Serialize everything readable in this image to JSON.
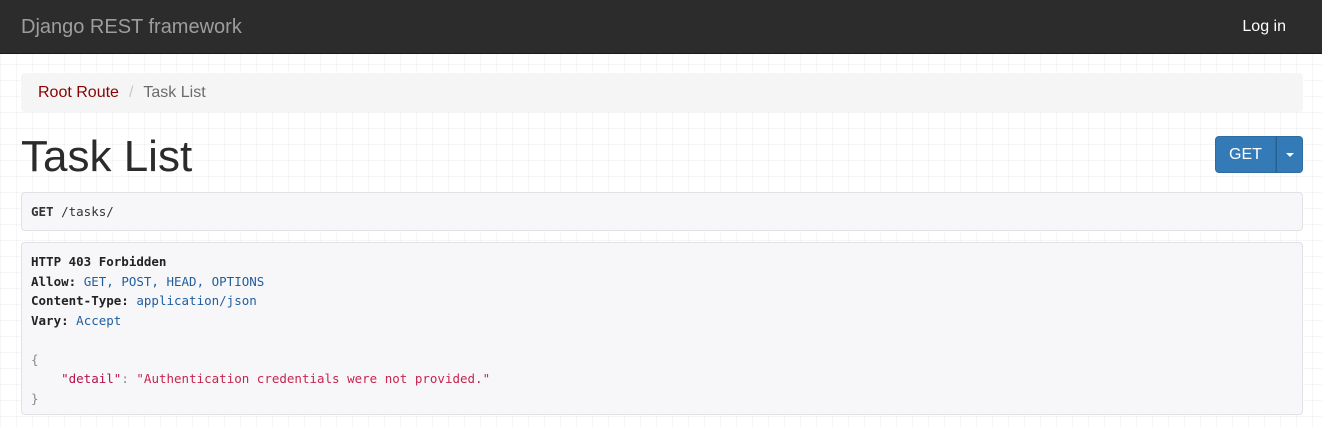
{
  "navbar": {
    "brand": "Django REST framework",
    "login_label": "Log in"
  },
  "breadcrumb": {
    "items": [
      {
        "label": "Root Route",
        "active": false
      },
      {
        "label": "Task List",
        "active": true
      }
    ],
    "separator": "/"
  },
  "page": {
    "title": "Task List"
  },
  "actions": {
    "method_button": "GET"
  },
  "request": {
    "method": "GET",
    "path": "/tasks/"
  },
  "response": {
    "status_line": "HTTP 403 Forbidden",
    "headers": [
      {
        "key": "Allow:",
        "value": "GET, POST, HEAD, OPTIONS"
      },
      {
        "key": "Content-Type:",
        "value": "application/json"
      },
      {
        "key": "Vary:",
        "value": "Accept"
      }
    ],
    "body": {
      "open_brace": "{",
      "key": "\"detail\"",
      "colon": ": ",
      "value": "\"Authentication credentials were not provided.\"",
      "close_brace": "}"
    }
  },
  "colors": {
    "navbar_bg": "#2c2c2c",
    "primary_button": "#337ab7",
    "breadcrumb_link": "#8b0000",
    "json_string": "#c7254e",
    "header_value": "#1f5fa0"
  }
}
